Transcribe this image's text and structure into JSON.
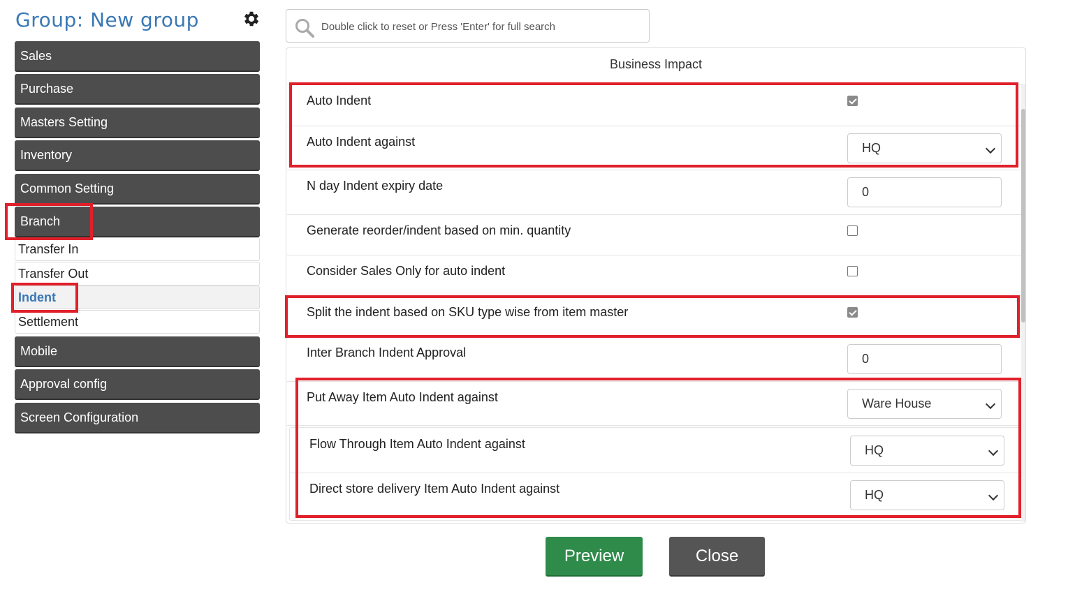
{
  "sidebar": {
    "title": "Group: New group",
    "menu": [
      "Sales",
      "Purchase",
      "Masters Setting",
      "Inventory",
      "Common Setting",
      "Branch"
    ],
    "branch_submenu": [
      "Transfer In",
      "Transfer Out",
      "Indent",
      "Settlement"
    ],
    "active_submenu": "Indent",
    "menu_after": [
      "Mobile",
      "Approval config",
      "Screen Configuration"
    ]
  },
  "search": {
    "placeholder": "Double click to reset or Press 'Enter' for full search"
  },
  "panel": {
    "title": "Business Impact",
    "rows": [
      {
        "label": "Auto Indent",
        "type": "checkbox",
        "checked": true
      },
      {
        "label": "Auto Indent against",
        "type": "select",
        "value": "HQ"
      },
      {
        "label": "N day Indent expiry date",
        "type": "input",
        "value": "0"
      },
      {
        "label": "Generate reorder/indent based on min. quantity",
        "type": "checkbox",
        "checked": false
      },
      {
        "label": "Consider Sales Only for auto indent",
        "type": "checkbox",
        "checked": false
      },
      {
        "label": "Split the indent based on SKU type wise from item master",
        "type": "checkbox",
        "checked": true
      },
      {
        "label": "Inter Branch Indent Approval",
        "type": "input",
        "value": "0"
      },
      {
        "label": "Put Away Item Auto Indent against",
        "type": "select",
        "value": "Ware House"
      },
      {
        "label": "Flow Through Item Auto Indent against",
        "type": "select",
        "value": "HQ"
      },
      {
        "label": "Direct store delivery Item Auto Indent against",
        "type": "select",
        "value": "HQ"
      }
    ]
  },
  "footer": {
    "preview_label": "Preview",
    "close_label": "Close"
  },
  "colors": {
    "menu_bg": "#4d4d4d",
    "title_blue": "#3a78b5",
    "highlight_red": "#e0202a",
    "preview_green": "#2e8b4a",
    "close_gray": "#555555"
  }
}
